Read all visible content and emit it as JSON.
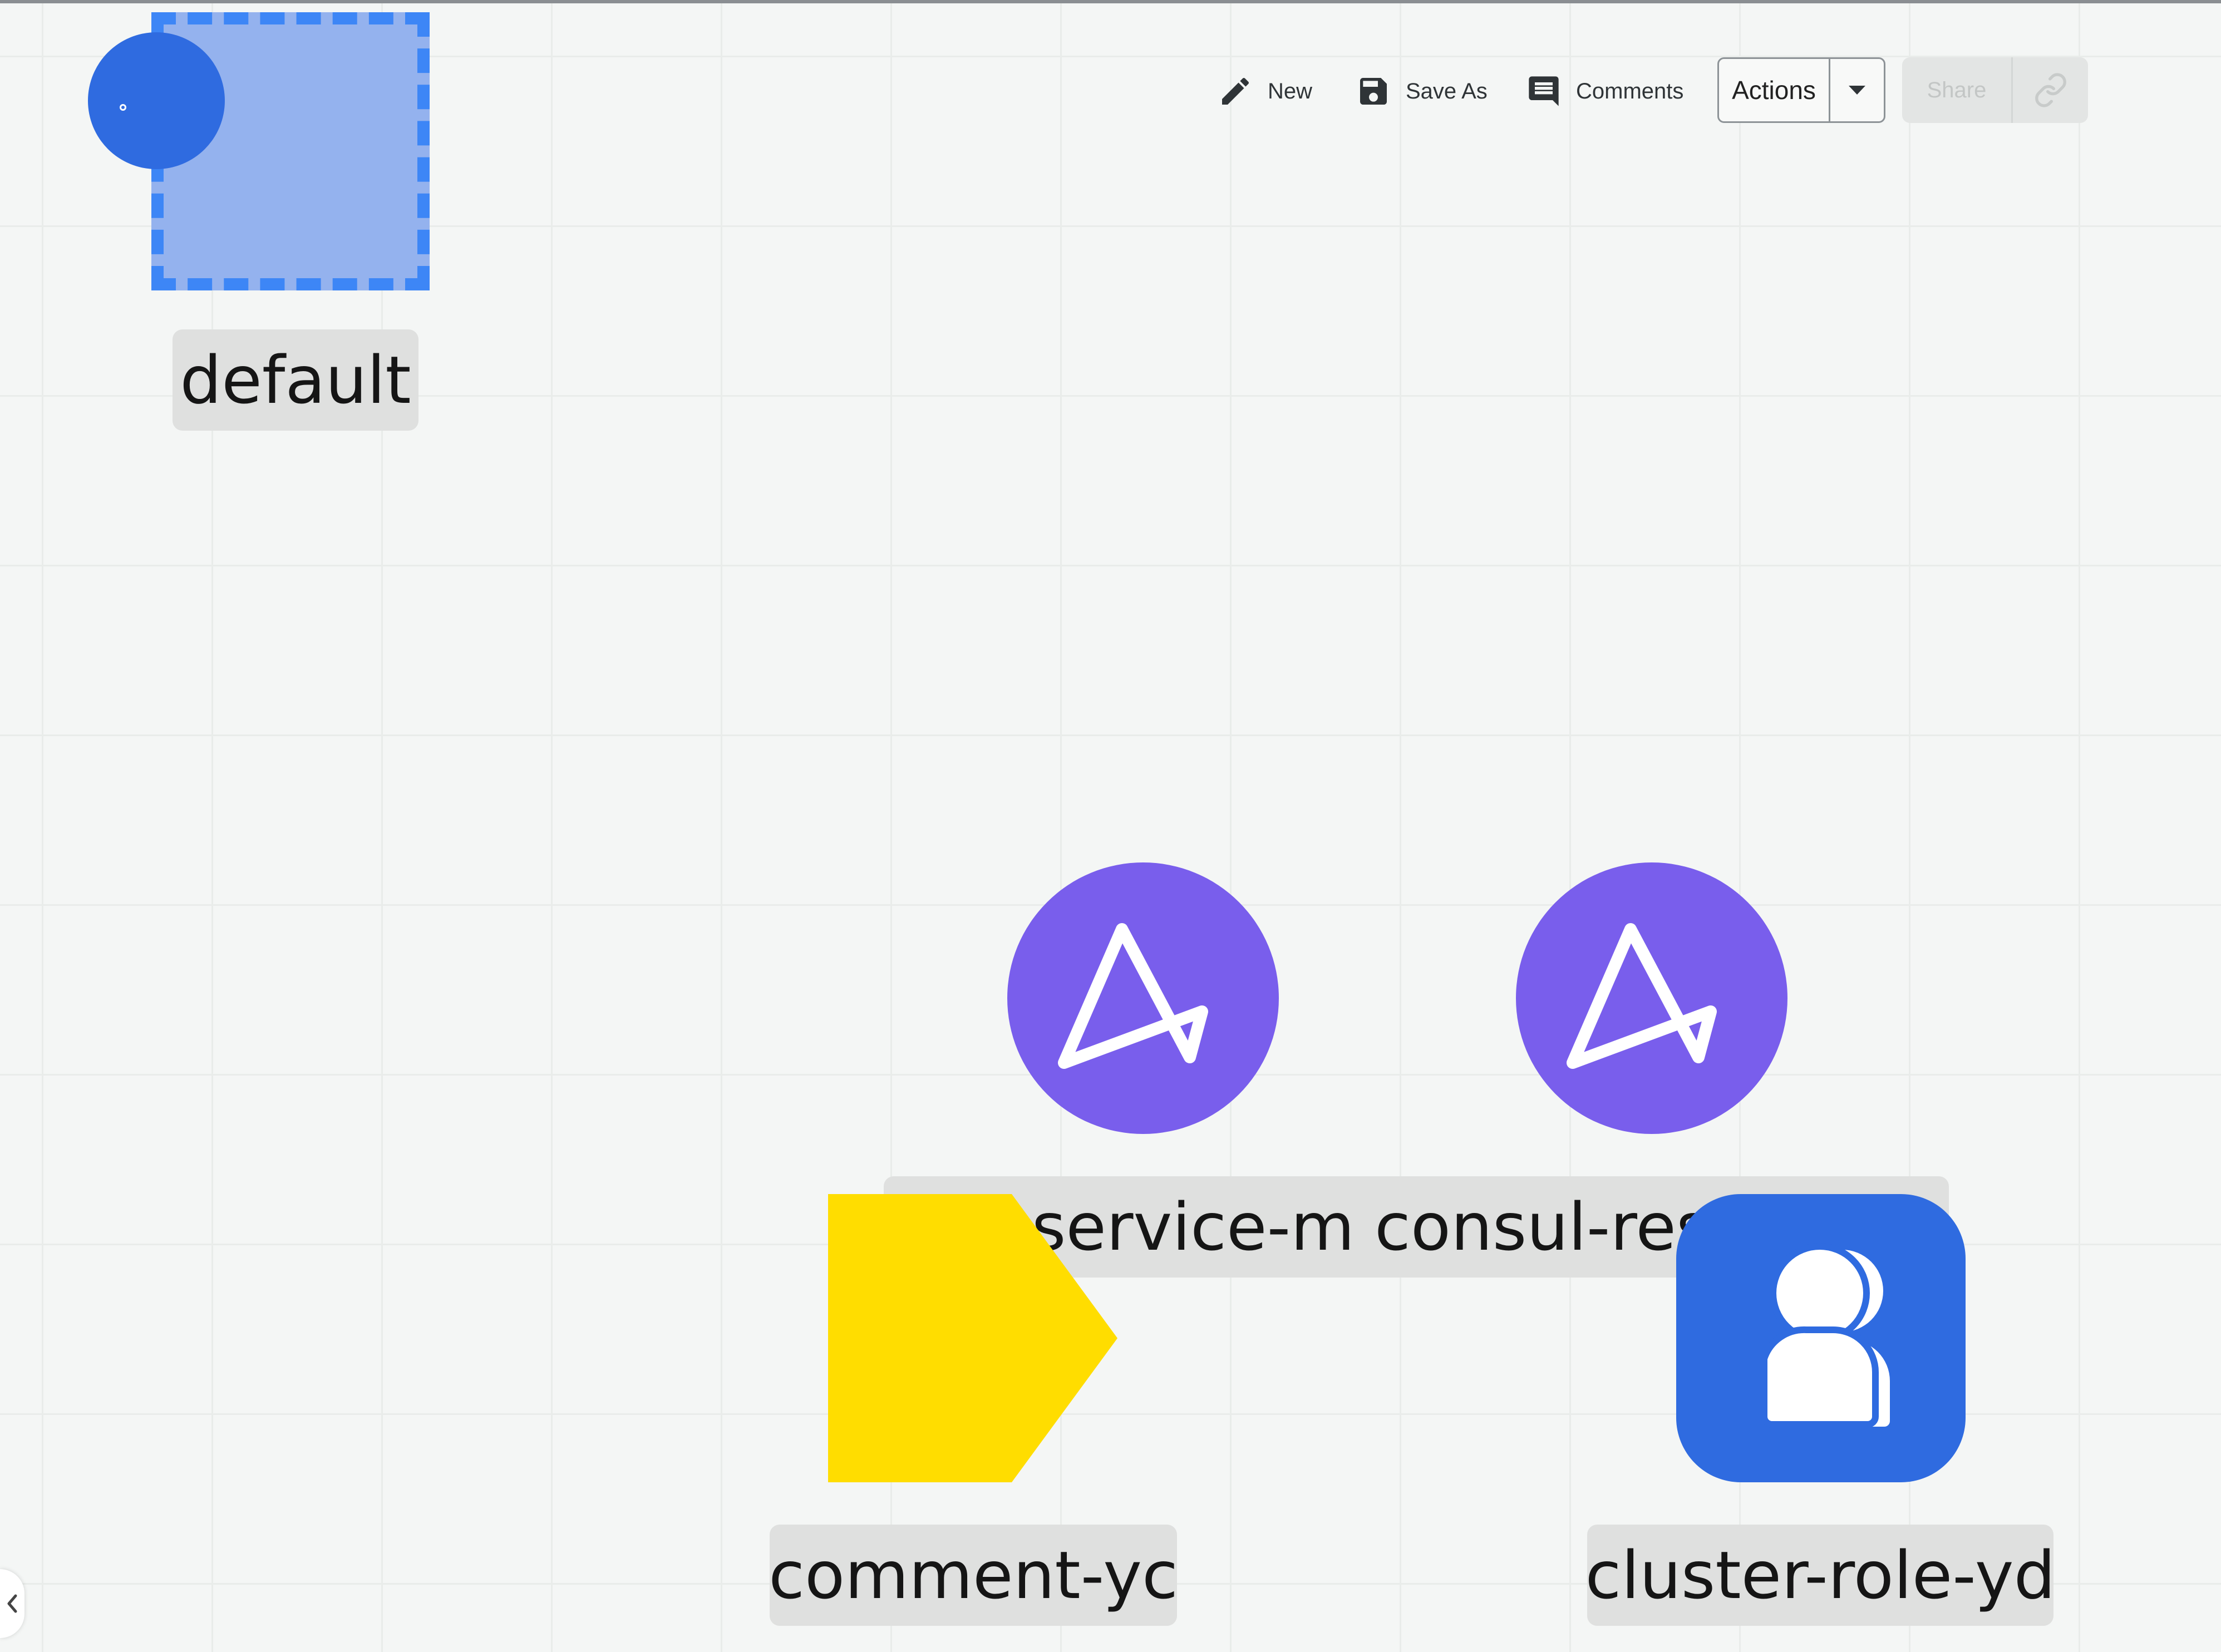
{
  "toolbar": {
    "new_label": "New",
    "save_as_label": "Save As",
    "comments_label": "Comments",
    "actions_label": "Actions",
    "share_label": "Share"
  },
  "canvas": {
    "nodes": {
      "namespace": {
        "label": "default",
        "icon": "namespace-icon",
        "color": "#94b2ee",
        "border_color": "#3d86f6"
      },
      "service": {
        "label": "-service-mx",
        "icon": "argo-icon",
        "color": "#795eec"
      },
      "consul": {
        "label": "consul-reso",
        "trailing_fragment": "l",
        "icon": "argo-icon",
        "color": "#795eec"
      },
      "comment": {
        "label": "comment-yc",
        "icon": "pentagon-shape",
        "color": "#ffdd00"
      },
      "cluster_role": {
        "label": "cluster-role-yd",
        "icon": "users-icon",
        "color": "#2f6be0"
      }
    }
  },
  "colors": {
    "canvas_bg": "#f4f6f5",
    "grid": "#e9ecea",
    "label_bg": "#dfe0df",
    "accent_blue": "#2f6be0"
  }
}
